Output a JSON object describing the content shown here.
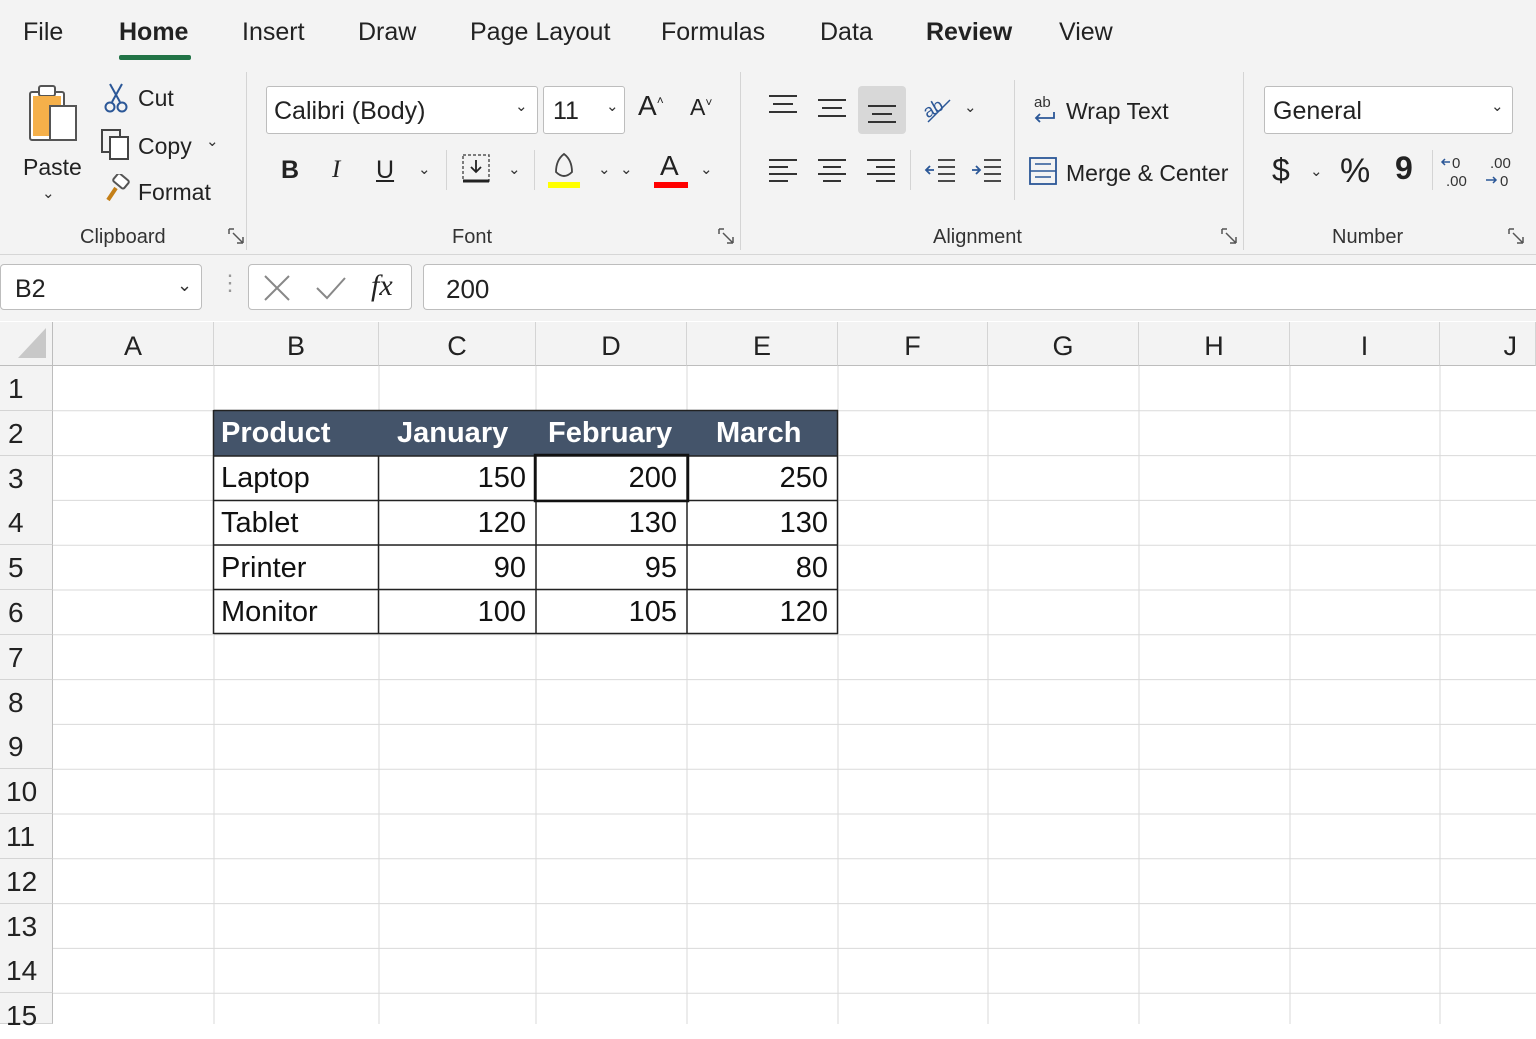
{
  "tabs": [
    "File",
    "Home",
    "Insert",
    "Draw",
    "Page Layout",
    "Formulas",
    "Data",
    "Review",
    "View"
  ],
  "active_tab": "Home",
  "clipboard": {
    "paste": "Paste",
    "cut": "Cut",
    "copy": "Copy",
    "format": "Format",
    "group": "Clipboard"
  },
  "font": {
    "name": "Calibri (Body)",
    "size": "11",
    "bold": "B",
    "italic": "I",
    "underline": "U",
    "font_color_glyph": "A",
    "group": "Font",
    "highlight_color": "#ffff00",
    "font_color": "#ff0000"
  },
  "alignment": {
    "wrap_text": "Wrap Text",
    "merge_center": "Merge & Center",
    "wrap_icon_text": "ab",
    "group": "Alignment"
  },
  "number": {
    "format": "General",
    "currency": "$",
    "percent": "%",
    "comma": "9",
    "group": "Number"
  },
  "formula_bar": {
    "name_box": "B2",
    "fx": "fx",
    "value": "200"
  },
  "grid": {
    "columns": [
      "A",
      "B",
      "C",
      "D",
      "E",
      "F",
      "G",
      "H",
      "I",
      "J"
    ],
    "rows": [
      "1",
      "2",
      "3",
      "4",
      "5",
      "6",
      "7",
      "8",
      "9",
      "10",
      "11",
      "12",
      "13",
      "14",
      "15"
    ],
    "table_header": [
      "Product",
      "January",
      "February",
      "March"
    ],
    "table_rows": [
      {
        "product": "Laptop",
        "jan": "150",
        "feb": "200",
        "mar": "250"
      },
      {
        "product": "Tablet",
        "jan": "120",
        "feb": "130",
        "mar": "130"
      },
      {
        "product": "Printer",
        "jan": "90",
        "feb": "95",
        "mar": "80"
      },
      {
        "product": "Monitor",
        "jan": "100",
        "feb": "105",
        "mar": "120"
      }
    ],
    "header_fill": "#44546a",
    "selected_cell": "D3"
  },
  "colors": {
    "accent": "#217346",
    "ribbon_bg": "#f3f3f3"
  }
}
